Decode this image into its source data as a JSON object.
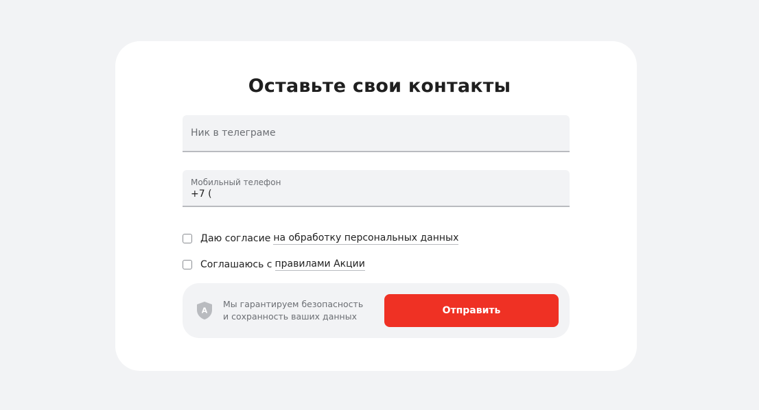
{
  "form": {
    "title": "Оставьте свои контакты",
    "nick_field": {
      "placeholder": "Ник в телеграме",
      "value": ""
    },
    "phone_field": {
      "label": "Мобильный телефон",
      "value": "+7 ("
    },
    "consent_personal": {
      "text": "Даю согласие",
      "link_text": "на обработку персональных данных",
      "checked": false
    },
    "consent_rules": {
      "text": "Соглашаюсь с",
      "link_text": "правилами Акции",
      "checked": false
    },
    "security": {
      "icon": "shield-icon",
      "line1": "Мы гарантируем безопасность",
      "line2": "и сохранность ваших данных"
    },
    "submit_label": "Отправить"
  },
  "colors": {
    "page_background": "#f2f3f5",
    "card_background": "#ffffff",
    "accent": "#ef3124",
    "muted_text": "#6b6e73",
    "field_background": "#f2f3f5"
  }
}
